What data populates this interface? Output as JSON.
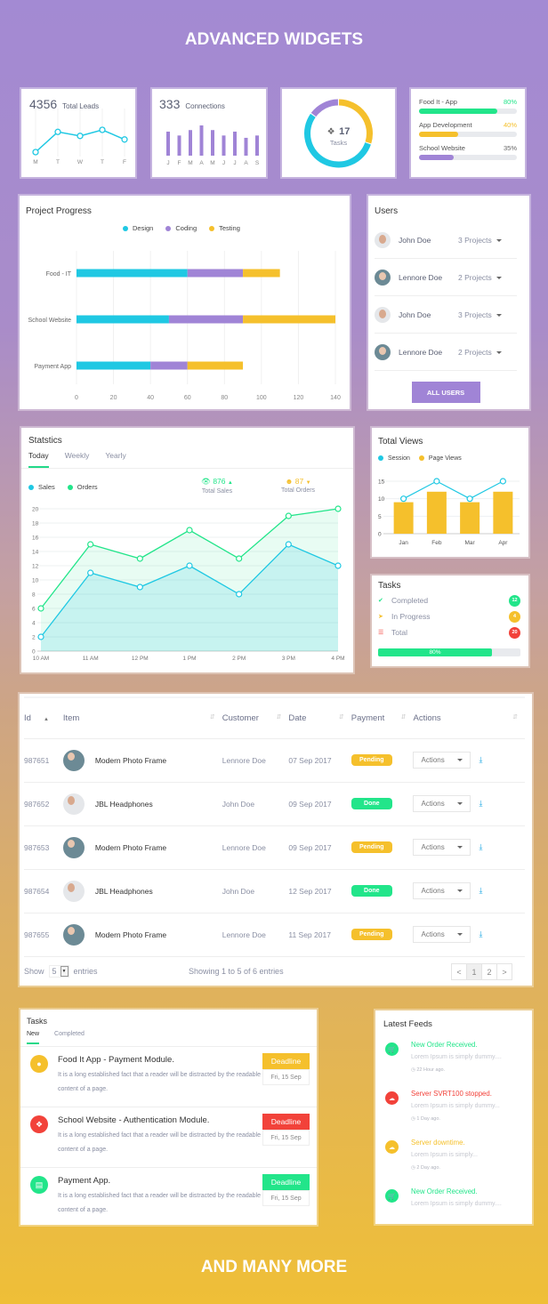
{
  "page": {
    "heading_top": "ADVANCED WIDGETS",
    "heading_bottom": "AND MANY MORE"
  },
  "colors": {
    "cyan": "#1fc8e3",
    "purple": "#a084d6",
    "yellow": "#f5c02c",
    "green": "#22e58a",
    "red": "#f2423a"
  },
  "leads_widget": {
    "value": "4356",
    "label": "Total Leads",
    "days": [
      "M",
      "T",
      "W",
      "T",
      "F"
    ],
    "values": [
      2,
      6,
      5.2,
      6.4,
      4.5
    ]
  },
  "connections_widget": {
    "value": "333",
    "label": "Connections",
    "months": [
      "J",
      "F",
      "M",
      "A",
      "M",
      "J",
      "J",
      "A",
      "S"
    ],
    "values": [
      31,
      26,
      33,
      39,
      33,
      26,
      31,
      23,
      26
    ]
  },
  "tasks_donut": {
    "value": "17",
    "label": "Tasks",
    "icon": "cubes-icon",
    "segments": [
      {
        "name": "yellow",
        "fraction": 0.3,
        "color": "#f5c02c"
      },
      {
        "name": "cyan",
        "fraction": 0.55,
        "color": "#1fc8e3"
      },
      {
        "name": "purple",
        "fraction": 0.15,
        "color": "#a084d6"
      }
    ]
  },
  "project_bars": [
    {
      "name": "Food It - App",
      "percent_label": "80%",
      "value": 80,
      "color": "#22e58a"
    },
    {
      "name": "App Development",
      "percent_label": "40%",
      "value": 40,
      "color": "#f5c02c"
    },
    {
      "name": "School Website",
      "percent_label": "35%",
      "value": 35,
      "color": "#a084d6"
    }
  ],
  "project_progress": {
    "title": "Project Progress",
    "chart_data": {
      "type": "bar",
      "orientation": "horizontal",
      "stacked": true,
      "categories": [
        "Food - IT",
        "School Website",
        "Payment App"
      ],
      "series": [
        {
          "name": "Design",
          "color": "#1fc8e3",
          "values": [
            60,
            50,
            40
          ]
        },
        {
          "name": "Coding",
          "color": "#a084d6",
          "values": [
            30,
            40,
            20
          ]
        },
        {
          "name": "Testing",
          "color": "#f5c02c",
          "values": [
            20,
            50,
            30
          ]
        }
      ],
      "xlim": [
        0,
        140
      ],
      "xticks": [
        0,
        20,
        40,
        60,
        80,
        100,
        120,
        140
      ],
      "legend": "top-center",
      "grid": true
    }
  },
  "users": {
    "title": "Users",
    "items": [
      {
        "name": "John Doe",
        "projects": "3 Projects",
        "gender": "m"
      },
      {
        "name": "Lennore Doe",
        "projects": "2 Projects",
        "gender": "f"
      },
      {
        "name": "John Doe",
        "projects": "3 Projects",
        "gender": "m"
      },
      {
        "name": "Lennore Doe",
        "projects": "2 Projects",
        "gender": "f"
      }
    ],
    "button": "ALL USERS"
  },
  "statistics": {
    "title": "Statstics",
    "tabs": [
      "Today",
      "Weekly",
      "Yearly"
    ],
    "active_tab": 0,
    "total_sales_value": "876",
    "total_sales_label": "Total Sales",
    "total_orders_value": "87",
    "total_orders_label": "Total Orders",
    "chart_data": {
      "type": "area",
      "x": [
        "10 AM",
        "11 AM",
        "12 PM",
        "1 PM",
        "2 PM",
        "3 PM",
        "4 PM"
      ],
      "series": [
        {
          "name": "Sales",
          "color": "#1fc8e3",
          "values": [
            2,
            11,
            9,
            12,
            8,
            15,
            12
          ]
        },
        {
          "name": "Orders",
          "color": "#22e58a",
          "values": [
            6,
            15,
            13,
            17,
            13,
            19,
            20
          ]
        }
      ],
      "ylim": [
        0,
        20
      ],
      "yticks": [
        0,
        2,
        4,
        6,
        8,
        10,
        12,
        14,
        16,
        18,
        20
      ],
      "legend": "top-left",
      "grid": true
    }
  },
  "total_views": {
    "title": "Total Views",
    "chart_data": {
      "type": "bar",
      "categories": [
        "Jan",
        "Feb",
        "Mar",
        "Apr"
      ],
      "series": [
        {
          "name": "Session",
          "type": "line",
          "color": "#1fc8e3",
          "values": [
            10,
            15,
            10,
            15
          ]
        },
        {
          "name": "Page Views",
          "type": "bar",
          "color": "#f5c02c",
          "values": [
            9,
            12,
            9,
            12
          ]
        }
      ],
      "ylim": [
        0,
        15
      ],
      "yticks": [
        0,
        5,
        10,
        15
      ],
      "legend": "top-left"
    }
  },
  "tasks_summary": {
    "title": "Tasks",
    "rows": [
      {
        "label": "Completed",
        "count": "12",
        "color": "#22e58a",
        "icon": "check-circle-icon"
      },
      {
        "label": "In Progress",
        "count": "4",
        "color": "#f5c02c",
        "icon": "rocket-icon"
      },
      {
        "label": "Total",
        "count": "20",
        "color": "#f2423a",
        "icon": "list-icon"
      }
    ],
    "progress_label": "80%",
    "progress_value": 0.8
  },
  "orders_table": {
    "columns": [
      "Id",
      "Item",
      "Customer",
      "Date",
      "Payment",
      "Actions"
    ],
    "rows": [
      {
        "id": "987651",
        "item": "Modern Photo Frame",
        "avatar": "f",
        "customer": "Lennore Doe",
        "date": "07 Sep 2017",
        "payment": "Pending",
        "action": "Actions"
      },
      {
        "id": "987652",
        "item": "JBL Headphones",
        "avatar": "m",
        "customer": "John Doe",
        "date": "09 Sep 2017",
        "payment": "Done",
        "action": "Actions"
      },
      {
        "id": "987653",
        "item": "Modern Photo Frame",
        "avatar": "f",
        "customer": "Lennore Doe",
        "date": "09 Sep 2017",
        "payment": "Pending",
        "action": "Actions"
      },
      {
        "id": "987654",
        "item": "JBL Headphones",
        "avatar": "m",
        "customer": "John Doe",
        "date": "12 Sep 2017",
        "payment": "Done",
        "action": "Actions"
      },
      {
        "id": "987655",
        "item": "Modern Photo Frame",
        "avatar": "f",
        "customer": "Lennore Doe",
        "date": "11 Sep 2017",
        "payment": "Pending",
        "action": "Actions"
      }
    ],
    "show_label": "Show",
    "show_value": "5",
    "entries_label": "entries",
    "summary": "Showing 1 to 5 of 6 entries",
    "pagination": [
      "<",
      "1",
      "2",
      ">"
    ],
    "current_page": "1"
  },
  "task_list": {
    "title": "Tasks",
    "tabs": [
      "New",
      "Completed"
    ],
    "active_tab": 0,
    "items": [
      {
        "title": "Food It App - Payment Module.",
        "desc": "It is a long established fact that a reader will be distracted by the readable content of a page.",
        "deadline_label": "Deadline",
        "date": "Fri, 15 Sep",
        "color": "#f5c02c",
        "icon": "coin-icon"
      },
      {
        "title": "School Website - Authentication Module.",
        "desc": "It is a long established fact that a reader will be distracted by the readable content of a page.",
        "deadline_label": "Deadline",
        "date": "Fri, 15 Sep",
        "color": "#f2423a",
        "icon": "cubes-icon"
      },
      {
        "title": "Payment App.",
        "desc": "It is a long established fact that a reader will be distracted by the readable content of a page.",
        "deadline_label": "Deadline",
        "date": "Fri, 15 Sep",
        "color": "#22e58a",
        "icon": "bank-icon"
      }
    ]
  },
  "feeds": {
    "title": "Latest Feeds",
    "items": [
      {
        "title": "New Order Received.",
        "desc": "Lorem Ipsum is simply dummy....",
        "time": "22 Hour ago.",
        "color": "#22e58a",
        "icon": "cart-icon"
      },
      {
        "title": "Server SVRT100 stopped.",
        "desc": "Lorem Ipsum is simply dummy...",
        "time": "1 Day ago.",
        "color": "#f2423a",
        "icon": "cloud-icon"
      },
      {
        "title": "Server downtime.",
        "desc": "Lorem Ipsum is simply...",
        "time": "2 Day ago.",
        "color": "#f5c02c",
        "icon": "cloud-upload-icon"
      },
      {
        "title": "New Order Received.",
        "desc": "Lorem Ipsum is simply dummy....",
        "time": "",
        "color": "#22e58a",
        "icon": "cart-icon"
      }
    ]
  }
}
